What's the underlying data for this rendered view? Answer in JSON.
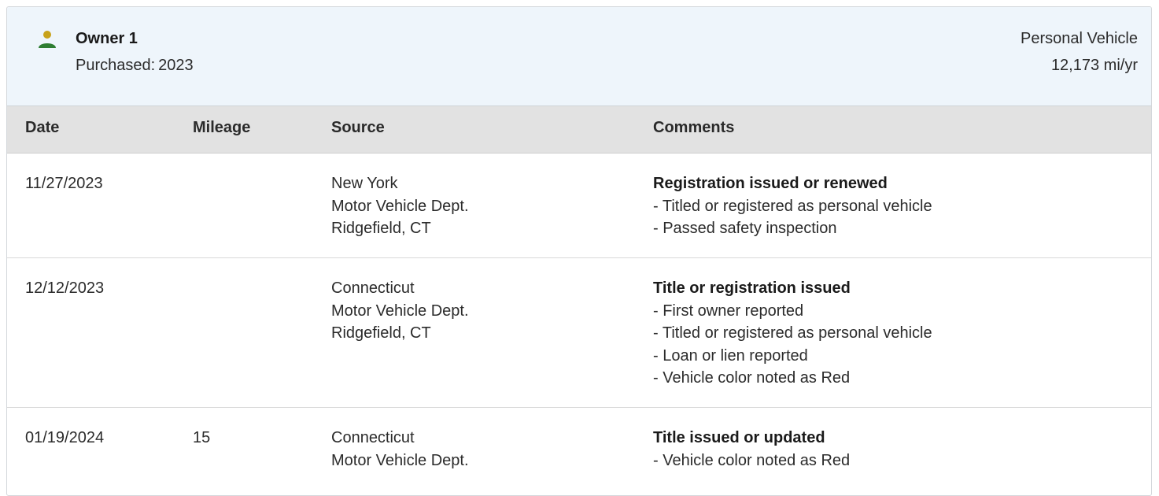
{
  "owner": {
    "title": "Owner 1",
    "purchased_label": "Purchased:",
    "purchased_year": "2023",
    "vehicle_type": "Personal Vehicle",
    "mileage_per_year": "12,173 mi/yr",
    "icon": "person-icon",
    "icon_colors": {
      "head": "#c8a21a",
      "body": "#2e7d32"
    }
  },
  "table": {
    "headers": [
      "Date",
      "Mileage",
      "Source",
      "Comments"
    ],
    "rows": [
      {
        "date": "11/27/2023",
        "mileage": "",
        "source": [
          "New York",
          "Motor Vehicle Dept.",
          "Ridgefield, CT"
        ],
        "comment_title": "Registration issued or renewed",
        "comment_items": [
          "- Titled or registered as personal vehicle",
          "- Passed safety inspection"
        ]
      },
      {
        "date": "12/12/2023",
        "mileage": "",
        "source": [
          "Connecticut",
          "Motor Vehicle Dept.",
          "Ridgefield, CT"
        ],
        "comment_title": "Title or registration issued",
        "comment_items": [
          "- First owner reported",
          "- Titled or registered as personal vehicle",
          "- Loan or lien reported",
          "- Vehicle color noted as Red"
        ]
      },
      {
        "date": "01/19/2024",
        "mileage": "15",
        "source": [
          "Connecticut",
          "Motor Vehicle Dept."
        ],
        "comment_title": "Title issued or updated",
        "comment_items": [
          "- Vehicle color noted as Red"
        ]
      }
    ]
  }
}
